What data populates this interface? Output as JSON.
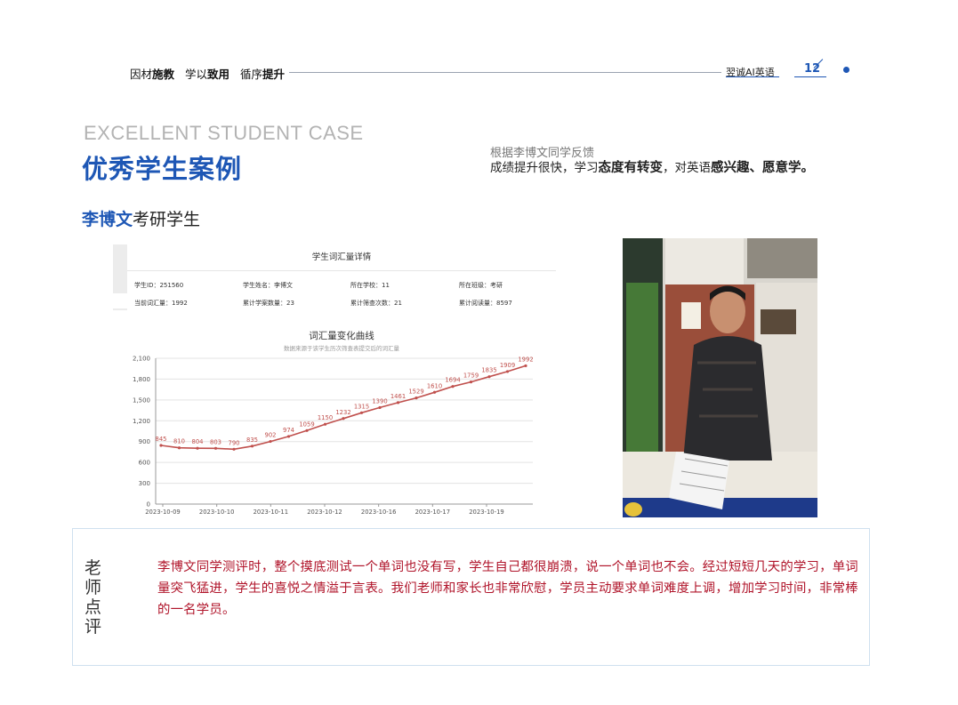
{
  "header": {
    "slogan": [
      {
        "normal": "因材",
        "bold": "施教"
      },
      {
        "normal": "学以",
        "bold": "致用"
      },
      {
        "normal": "循序",
        "bold": "提升"
      }
    ],
    "brand": "翌诚AI英语",
    "page_number": "12",
    "accent_color": "#1e57b5"
  },
  "titles": {
    "english": "EXCELLENT STUDENT CASE",
    "chinese": "优秀学生案例",
    "student_name": "李博文",
    "student_type": "考研学生"
  },
  "feedback": {
    "line1": "根据李博文同学反馈",
    "line2_parts": [
      {
        "text": "成绩提升很快，学习",
        "bold": false
      },
      {
        "text": "态度有转变",
        "bold": true
      },
      {
        "text": "，对英语",
        "bold": false
      },
      {
        "text": "感兴趣、愿意学。",
        "bold": true
      }
    ]
  },
  "vocab_card": {
    "header": "学生词汇量详情",
    "info": [
      [
        "学生ID：251560",
        "学生姓名：李博文",
        "所在学校：11",
        "所在班级：考研"
      ],
      [
        "当前词汇量：1992",
        "累计学案数量：23",
        "累计筛查次数：21",
        "累计阅读量：8597"
      ]
    ]
  },
  "chart_data": {
    "type": "line",
    "title": "词汇量变化曲线",
    "subtitle": "数据来源于该学生历次筛查表提交后的词汇量",
    "xlabel": "",
    "ylabel": "",
    "ylim": [
      0,
      2100
    ],
    "yticks": [
      "0",
      "300",
      "600",
      "900",
      "1,200",
      "1,500",
      "1,800",
      "2,100"
    ],
    "xtick_labels": [
      "2023-10-09",
      "2023-10-10",
      "2023-10-11",
      "2023-10-12",
      "2023-10-16",
      "2023-10-17",
      "2023-10-19"
    ],
    "values": [
      845,
      810,
      804,
      803,
      790,
      835,
      902,
      974,
      1059,
      1150,
      1232,
      1315,
      1390,
      1461,
      1529,
      1610,
      1694,
      1759,
      1835,
      1909,
      1992
    ],
    "line_color": "#c0504d",
    "grid": true,
    "legend": "none"
  },
  "comment": {
    "label": [
      "老",
      "师",
      "点",
      "评"
    ],
    "text": "李博文同学测评时，整个摸底测试一个单词也没有写，学生自己都很崩溃，说一个单词也不会。经过短短几天的学习，单词量突飞猛进，学生的喜悦之情溢于言表。我们老师和家长也非常欣慰，学员主动要求单词难度上调，增加学习时间，非常棒的一名学员。",
    "text_color": "#b0142a"
  },
  "photo": {
    "icon": "student-photo"
  }
}
